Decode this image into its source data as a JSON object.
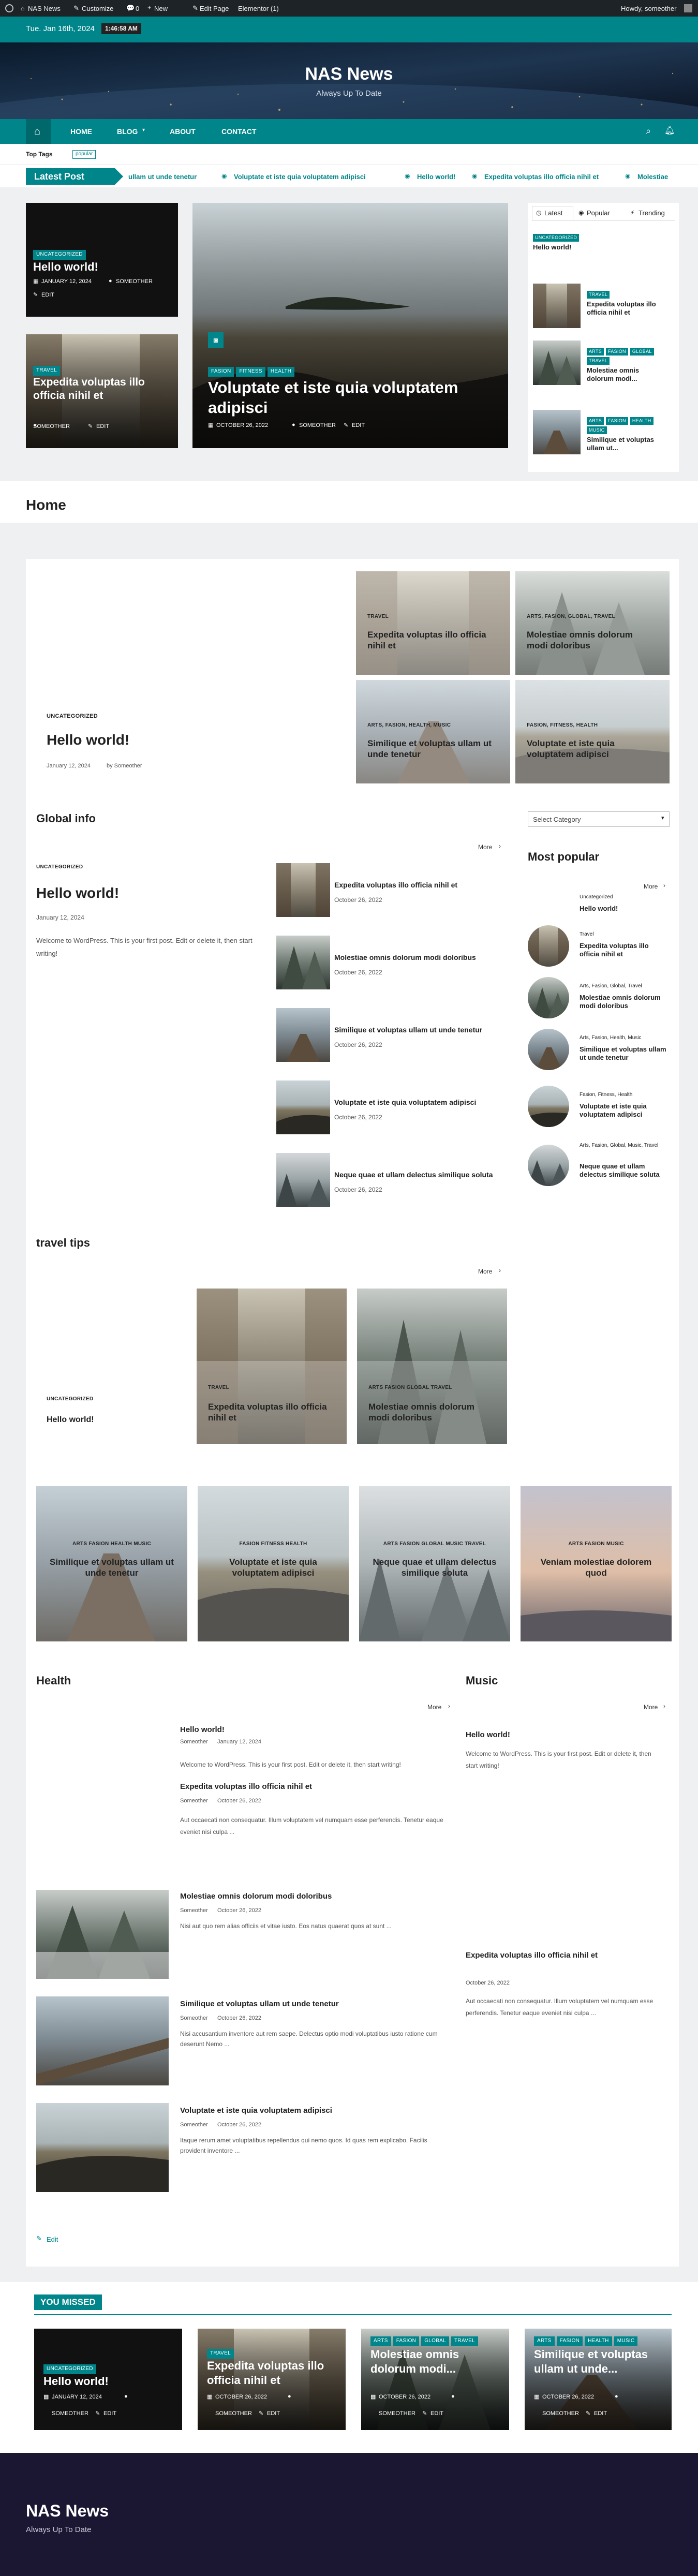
{
  "adminbar": {
    "site": "NAS News",
    "customize": "Customize",
    "comments": "0",
    "new": "New",
    "edit_page": "Edit Page",
    "elementor": "Elementor (1)",
    "howdy": "Howdy, someother"
  },
  "topbar": {
    "date": "Tue. Jan 16th, 2024",
    "time": "1:46:58 AM"
  },
  "header": {
    "title": "NAS News",
    "tagline": "Always Up To Date"
  },
  "nav": {
    "items": [
      "HOME",
      "BLOG",
      "ABOUT",
      "CONTACT"
    ]
  },
  "tags": {
    "label": "Top Tags",
    "tag": "popular"
  },
  "ticker": {
    "label": "Latest Post",
    "items": [
      "ullam ut unde tenetur",
      "Voluptate et iste quia voluptatem adipisci",
      "Hello world!",
      "Expedita voluptas illo officia nihil et",
      "Molestiae"
    ]
  },
  "hero": {
    "left1": {
      "badge": "UNCATEGORIZED",
      "title": "Hello world!",
      "date": "JANUARY 12, 2024",
      "author": "SOMEOTHER",
      "edit": "EDIT"
    },
    "left2": {
      "badge": "TRAVEL",
      "title": "Expedita voluptas illo officia nihil et",
      "author": "SOMEOTHER",
      "edit": "EDIT"
    },
    "main": {
      "badges": [
        "FASION",
        "FITNESS",
        "HEALTH"
      ],
      "title": "Voluptate et iste quia voluptatem adipisci",
      "date": "OCTOBER 26, 2022",
      "author": "SOMEOTHER",
      "edit": "EDIT"
    },
    "tabs": [
      "Latest",
      "Popular",
      "Trending"
    ],
    "side": [
      {
        "badges": [
          "UNCATEGORIZED"
        ],
        "title": "Hello world!"
      },
      {
        "badges": [
          "TRAVEL"
        ],
        "title": "Expedita voluptas illo officia nihil et"
      },
      {
        "badges": [
          "ARTS",
          "FASION",
          "GLOBAL",
          "TRAVEL"
        ],
        "title": "Molestiae omnis dolorum modi..."
      },
      {
        "badges": [
          "ARTS",
          "FASION",
          "HEALTH",
          "MUSIC"
        ],
        "title": "Similique et voluptas ullam ut..."
      }
    ]
  },
  "page_title": "Home",
  "featured": {
    "cat": "UNCATEGORIZED",
    "title": "Hello world!",
    "date": "January 12, 2024",
    "by": "by Someother",
    "grid": [
      {
        "cat": "TRAVEL",
        "title": "Expedita voluptas illo officia nihil et"
      },
      {
        "cat": "ARTS, FASION, GLOBAL, TRAVEL",
        "title": "Molestiae omnis dolorum modi doloribus"
      },
      {
        "cat": "ARTS, FASION, HEALTH, MUSIC",
        "title": "Similique et voluptas ullam ut unde tenetur"
      },
      {
        "cat": "FASION, FITNESS, HEALTH",
        "title": "Voluptate et iste quia voluptatem adipisci"
      }
    ]
  },
  "global": {
    "heading": "Global info",
    "more": "More",
    "main": {
      "cat": "UNCATEGORIZED",
      "title": "Hello world!",
      "date": "January 12, 2024",
      "excerpt": "Welcome to WordPress. This is your first post. Edit or delete it, then start writing!"
    },
    "list": [
      {
        "title": "Expedita voluptas illo officia nihil et",
        "date": "October 26, 2022"
      },
      {
        "title": "Molestiae omnis dolorum modi doloribus",
        "date": "October 26, 2022"
      },
      {
        "title": "Similique et voluptas ullam ut unde tenetur",
        "date": "October 26, 2022"
      },
      {
        "title": "Voluptate et iste quia voluptatem adipisci",
        "date": "October 26, 2022"
      },
      {
        "title": "Neque quae et ullam delectus similique soluta",
        "date": "October 26, 2022"
      }
    ]
  },
  "sidebar": {
    "select": "Select Category",
    "popular_heading": "Most popular",
    "more": "More",
    "items": [
      {
        "cat": "Uncategorized",
        "title": "Hello world!"
      },
      {
        "cat": "Travel",
        "title": "Expedita voluptas illo officia nihil et"
      },
      {
        "cat": "Arts, Fasion, Global, Travel",
        "title": "Molestiae omnis dolorum modi doloribus"
      },
      {
        "cat": "Arts, Fasion, Health, Music",
        "title": "Similique et voluptas ullam ut unde tenetur"
      },
      {
        "cat": "Fasion, Fitness, Health",
        "title": "Voluptate et iste quia voluptatem adipisci"
      },
      {
        "cat": "Arts, Fasion, Global, Music, Travel",
        "title": "Neque quae et ullam delectus similique soluta"
      }
    ]
  },
  "travel": {
    "heading": "travel tips",
    "more": "More",
    "main": {
      "cat": "UNCATEGORIZED",
      "title": "Hello world!"
    },
    "cards": [
      {
        "cat": "TRAVEL",
        "title": "Expedita voluptas illo officia nihil et"
      },
      {
        "cat": "ARTS FASION GLOBAL TRAVEL",
        "title": "Molestiae omnis dolorum modi doloribus"
      }
    ]
  },
  "fourcards": [
    {
      "cat": "ARTS FASION HEALTH MUSIC",
      "title": "Similique et voluptas ullam ut unde tenetur"
    },
    {
      "cat": "FASION FITNESS HEALTH",
      "title": "Voluptate et iste quia voluptatem adipisci"
    },
    {
      "cat": "ARTS FASION GLOBAL MUSIC TRAVEL",
      "title": "Neque quae et ullam delectus similique soluta"
    },
    {
      "cat": "ARTS FASION MUSIC",
      "title": "Veniam molestiae dolorem quod"
    }
  ],
  "health": {
    "heading": "Health",
    "more": "More",
    "top": [
      {
        "title": "Hello world!",
        "author": "Someother",
        "date": "January 12, 2024",
        "excerpt": "Welcome to WordPress. This is your first post. Edit or delete it, then start writing!"
      },
      {
        "title": "Expedita voluptas illo officia nihil et",
        "author": "Someother",
        "date": "October 26, 2022",
        "excerpt": "Aut occaecati non consequatur. Illum voluptatem vel numquam esse perferendis. Tenetur eaque eveniet nisi culpa ..."
      }
    ],
    "list": [
      {
        "title": "Molestiae omnis dolorum modi doloribus",
        "author": "Someother",
        "date": "October 26, 2022",
        "excerpt": "Nisi aut quo rem alias officiis et vitae iusto. Eos natus quaerat quos at sunt ..."
      },
      {
        "title": "Similique et voluptas ullam ut unde tenetur",
        "author": "Someother",
        "date": "October 26, 2022",
        "excerpt": "Nisi accusantium inventore aut rem saepe. Delectus optio modi voluptatibus iusto ratione cum deserunt Nemo ..."
      },
      {
        "title": "Voluptate et iste quia voluptatem adipisci",
        "author": "Someother",
        "date": "October 26, 2022",
        "excerpt": "Itaque rerum amet voluptatibus repellendus qui nemo quos. Id quas rem explicabo. Facilis provident inventore ..."
      }
    ]
  },
  "music": {
    "heading": "Music",
    "more": "More",
    "p1": {
      "title": "Hello world!",
      "excerpt": "Welcome to WordPress. This is your first post. Edit or delete it, then start writing!"
    },
    "p2": {
      "title": "Expedita voluptas illo officia nihil et",
      "date": "October 26, 2022",
      "excerpt": "Aut occaecati non consequatur. Illum voluptatem vel numquam esse perferendis. Tenetur eaque eveniet nisi culpa ..."
    }
  },
  "edit_link": "Edit",
  "missed": {
    "heading": "YOU MISSED",
    "cards": [
      {
        "badges": [
          "UNCATEGORIZED"
        ],
        "title": "Hello world!",
        "date": "JANUARY 12, 2024",
        "author": "SOMEOTHER",
        "edit": "EDIT"
      },
      {
        "badges": [
          "TRAVEL"
        ],
        "title": "Expedita voluptas illo officia nihil et",
        "date": "OCTOBER 26, 2022",
        "author": "SOMEOTHER",
        "edit": "EDIT"
      },
      {
        "badges": [
          "ARTS",
          "FASION",
          "GLOBAL",
          "TRAVEL"
        ],
        "title": "Molestiae omnis dolorum modi...",
        "date": "OCTOBER 26, 2022",
        "author": "SOMEOTHER",
        "edit": "EDIT"
      },
      {
        "badges": [
          "ARTS",
          "FASION",
          "HEALTH",
          "MUSIC"
        ],
        "title": "Similique et voluptas ullam ut unde...",
        "date": "OCTOBER 26, 2022",
        "author": "SOMEOTHER",
        "edit": "EDIT"
      }
    ]
  },
  "footer": {
    "title": "NAS News",
    "tagline": "Always Up To Date"
  },
  "colors": {
    "accent": "#00858a",
    "dark": "#1b1733",
    "adminbar": "#1d2327"
  }
}
